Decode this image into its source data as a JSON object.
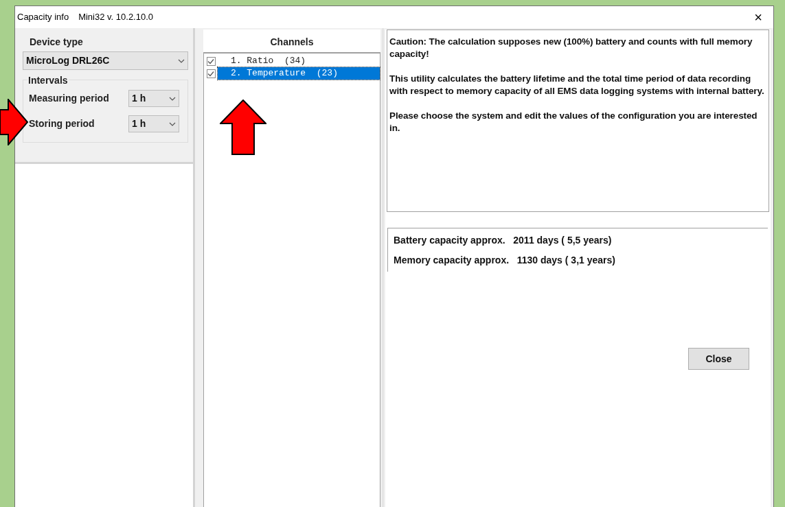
{
  "window": {
    "title": "Capacity info",
    "subtitle": "Mini32 v. 10.2.10.0",
    "close": "×"
  },
  "device_type": {
    "label": "Device type",
    "value": "MicroLog DRL26C"
  },
  "intervals": {
    "label": "Intervals",
    "fields": [
      {
        "label": "Measuring period",
        "value": "1 h"
      },
      {
        "label": "Storing period",
        "value": "1 h"
      }
    ]
  },
  "channels": {
    "title": "Channels",
    "items": [
      {
        "label": "1. Ratio  (34)",
        "checked": true,
        "selected": false
      },
      {
        "label": "2. Temperature  (23)",
        "checked": true,
        "selected": true
      }
    ]
  },
  "info": [
    "Caution: The calculation supposes new (100%) battery and counts with full memory capacity!",
    "This utility calculates the battery lifetime and the total time period of data recording with respect to memory capacity of all EMS data logging systems with internal battery.",
    "Please choose the system and edit the values of the configuration you are interested in."
  ],
  "results": [
    "Battery capacity approx.   2011 days ( 5,5 years)",
    "Memory capacity approx.   1130 days ( 3,1 years)"
  ],
  "buttons": [
    "Close"
  ]
}
